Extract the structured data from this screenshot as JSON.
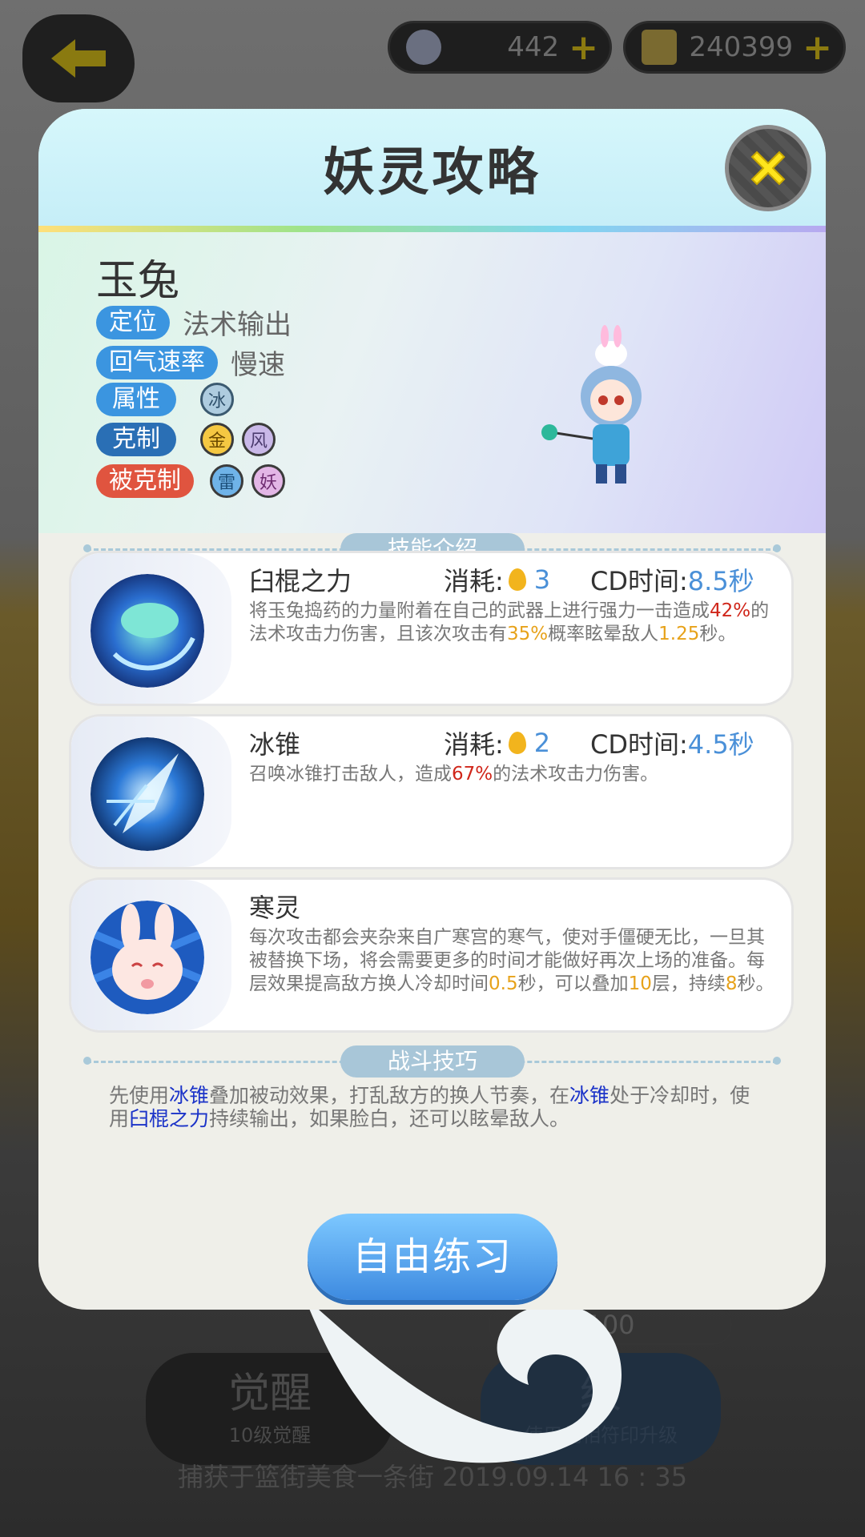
{
  "topbar": {
    "back_icon": "back-arrow-icon",
    "stamina": {
      "icon": "avatar-coin-icon",
      "value": "442",
      "plus": "+"
    },
    "gold": {
      "icon": "gold-coin-icon",
      "value": "240399",
      "plus": "+"
    }
  },
  "modal": {
    "title": "妖灵攻略",
    "close_icon": "close-icon",
    "hero": {
      "name": "玉兔",
      "role_label": "定位",
      "role_value": "法术输出",
      "recover_label": "回气速率",
      "recover_value": "慢速",
      "element_label": "属性",
      "elements": [
        "冰"
      ],
      "counters_label": "克制",
      "counters": [
        "金",
        "风"
      ],
      "countered_label": "被克制",
      "countered_by": [
        "雷",
        "妖"
      ]
    },
    "skills_section_title": "技能介绍",
    "cost_label": "消耗:",
    "cd_label": "CD时间:",
    "skills": [
      {
        "name": "臼棍之力",
        "cost": "3",
        "cd": "8.5秒",
        "desc_parts": [
          "将玉兔捣药的力量附着在自己的武器上进行强力一击造成",
          "42%",
          "的法术攻击力伤害，且该次攻击有",
          "35%",
          "概率眩晕敌人",
          "1.25",
          "秒。"
        ]
      },
      {
        "name": "冰锥",
        "cost": "2",
        "cd": "4.5秒",
        "desc_parts": [
          "召唤冰锥打击敌人，造成",
          "67%",
          "的法术攻击力伤害。"
        ]
      },
      {
        "name": "寒灵",
        "desc_parts": [
          "每次攻击都会夹杂来自广寒宫的寒气，使对手僵硬无比，一旦其被替换下场，将会需要更多的时间才能做好再次上场的准备。每层效果提高敌方换人冷却时间",
          "0.5",
          "秒，可以叠加",
          "10",
          "层，持续",
          "8",
          "秒。"
        ]
      }
    ],
    "tips_section_title": "战斗技巧",
    "tips_parts": [
      "先使用",
      "冰锥",
      "叠加被动效果，打乱敌方的换人节奏，在",
      "冰锥",
      "处于冷却时，使用",
      "臼棍之力",
      "持续输出，如果脸白，还可以眩晕敌人。"
    ],
    "practice_button": "自由练习"
  },
  "background": {
    "price_value": "100",
    "awaken_button": "觉醒",
    "awaken_sub": "10级觉醒",
    "upgrade_button": "级",
    "upgrade_sub": "使用兑相符印升级",
    "captured_text": "捕获于篮街美食一条街  2019.09.14   16 : 35"
  },
  "colors": {
    "accent_blue": "#3b95e0",
    "highlight_red": "#d0261a",
    "highlight_orange": "#e7a21a",
    "highlight_blue": "#1b33c8"
  }
}
